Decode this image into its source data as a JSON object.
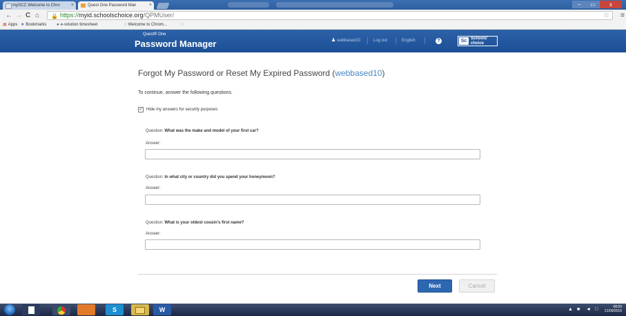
{
  "browser": {
    "tabs": [
      {
        "title": "mySCC Welcome to Chro",
        "close": "×"
      },
      {
        "title": "Quest One Password Man",
        "close": "×"
      }
    ],
    "window_controls": {
      "minimize": "–",
      "maximize": "▭",
      "close": "x"
    },
    "nav": {
      "back": "←",
      "forward": "→",
      "reload": "C",
      "home": "⌂"
    },
    "url": {
      "protocol": "https://",
      "host": "myid.schoolschoice.org",
      "path": "/QPMUser/"
    },
    "bookmarks": [
      "Apps",
      "Bookmarks",
      "e-volution timesheet",
      "Welcome to Chrom..."
    ]
  },
  "header": {
    "brand_small": "Quest® One",
    "brand_main": "Password Manager",
    "username": "webbased10",
    "logout": "Log out",
    "language": "English",
    "help": "?",
    "logo_mark": "Sc",
    "logo_text_line1": "Schools'",
    "logo_text_line2": "choice"
  },
  "main": {
    "title_prefix": "Forgot My Password or Reset My Expired Password (",
    "title_user": "webbased10",
    "title_suffix": ")",
    "intro": "To continue, answer the following questions.",
    "hide_answers_label": "Hide my answers for security purposes",
    "hide_answers_checked": true,
    "question_prefix": "Question:",
    "answer_label": "Answer:",
    "questions": [
      {
        "text": "What was the make and model of your first car?",
        "answer": ""
      },
      {
        "text": "In what city or country did you spend your honeymoon?",
        "answer": ""
      },
      {
        "text": "What is your oldest cousin's first name?",
        "answer": ""
      }
    ],
    "next_label": "Next",
    "cancel_label": "Cancel"
  },
  "taskbar": {
    "apps": [
      "",
      "",
      "",
      "S",
      "",
      "W"
    ],
    "clock_time": "08:55",
    "clock_date": "21/09/2015"
  },
  "colors": {
    "header_blue": "#1c4f96",
    "primary_button": "#2d67b2",
    "link_blue": "#4a86c5"
  }
}
